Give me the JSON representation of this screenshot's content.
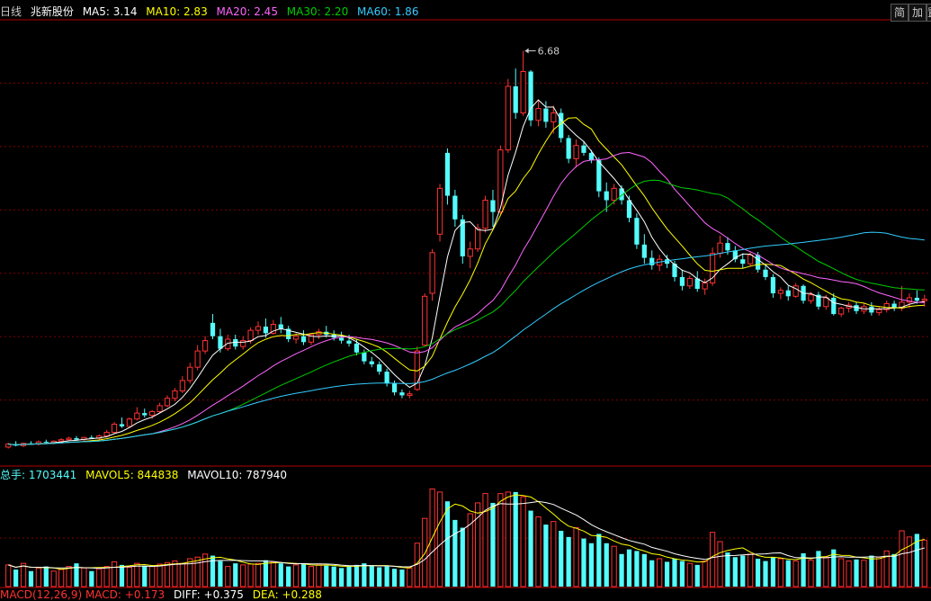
{
  "header": {
    "period": "日线",
    "stock_name": "兆新股份",
    "ma": [
      {
        "label": "MA5: 3.14",
        "color": "#ffffff"
      },
      {
        "label": "MA10: 2.83",
        "color": "#ffff00"
      },
      {
        "label": "MA20: 2.45",
        "color": "#ff66ff"
      },
      {
        "label": "MA30: 2.20",
        "color": "#00cc00"
      },
      {
        "label": "MA60: 1.86",
        "color": "#33ccff"
      }
    ]
  },
  "toolbar": {
    "simple_label": "简",
    "add_label": "加",
    "third_label": "置"
  },
  "volume_header": {
    "total": "总手: 1703441",
    "mavol5": "MAVOL5: 844838",
    "mavol10": "MAVOL10: 787940"
  },
  "macd_header": {
    "macd": "MACD(12,26,9)  MACD: +0.173",
    "diff": "DIFF: +0.375",
    "dea": "DEA: +0.288"
  },
  "colors": {
    "up": "#ff3232",
    "down": "#54fcfc",
    "grid": "#7f0000"
  },
  "chart_data": {
    "type": "candlestick",
    "annotations": [
      {
        "label": "6.68",
        "value": 6.68,
        "index": 68
      }
    ],
    "price_range": [
      1.1,
      7.1
    ],
    "candles": [
      [
        1.32,
        1.38,
        1.3,
        1.36
      ],
      [
        1.36,
        1.4,
        1.33,
        1.34
      ],
      [
        1.34,
        1.38,
        1.32,
        1.37
      ],
      [
        1.37,
        1.4,
        1.35,
        1.36
      ],
      [
        1.36,
        1.41,
        1.34,
        1.39
      ],
      [
        1.39,
        1.42,
        1.36,
        1.38
      ],
      [
        1.38,
        1.41,
        1.36,
        1.4
      ],
      [
        1.4,
        1.44,
        1.38,
        1.42
      ],
      [
        1.42,
        1.46,
        1.4,
        1.44
      ],
      [
        1.44,
        1.47,
        1.41,
        1.42
      ],
      [
        1.42,
        1.46,
        1.4,
        1.45
      ],
      [
        1.45,
        1.48,
        1.43,
        1.44
      ],
      [
        1.44,
        1.49,
        1.42,
        1.47
      ],
      [
        1.47,
        1.55,
        1.45,
        1.52
      ],
      [
        1.52,
        1.66,
        1.5,
        1.63
      ],
      [
        1.63,
        1.72,
        1.58,
        1.6
      ],
      [
        1.6,
        1.72,
        1.58,
        1.7
      ],
      [
        1.7,
        1.86,
        1.68,
        1.78
      ],
      [
        1.78,
        1.84,
        1.72,
        1.75
      ],
      [
        1.75,
        1.82,
        1.7,
        1.8
      ],
      [
        1.8,
        1.92,
        1.78,
        1.88
      ],
      [
        1.88,
        2.02,
        1.86,
        1.98
      ],
      [
        1.98,
        2.12,
        1.94,
        2.08
      ],
      [
        2.08,
        2.28,
        2.05,
        2.22
      ],
      [
        2.22,
        2.46,
        2.18,
        2.4
      ],
      [
        2.4,
        2.7,
        2.36,
        2.62
      ],
      [
        2.62,
        2.82,
        2.58,
        2.76
      ],
      [
        3.0,
        3.12,
        2.78,
        2.82
      ],
      [
        2.82,
        2.92,
        2.6,
        2.65
      ],
      [
        2.65,
        2.84,
        2.62,
        2.78
      ],
      [
        2.78,
        2.84,
        2.64,
        2.68
      ],
      [
        2.68,
        2.82,
        2.64,
        2.76
      ],
      [
        2.76,
        2.94,
        2.72,
        2.9
      ],
      [
        2.9,
        3.02,
        2.84,
        2.95
      ],
      [
        2.95,
        3.06,
        2.8,
        2.86
      ],
      [
        2.86,
        3.04,
        2.84,
        2.98
      ],
      [
        2.98,
        3.08,
        2.86,
        2.92
      ],
      [
        2.92,
        2.96,
        2.74,
        2.78
      ],
      [
        2.78,
        2.86,
        2.72,
        2.82
      ],
      [
        2.82,
        2.9,
        2.7,
        2.74
      ],
      [
        2.74,
        2.86,
        2.7,
        2.84
      ],
      [
        2.84,
        2.92,
        2.78,
        2.88
      ],
      [
        2.88,
        2.96,
        2.8,
        2.84
      ],
      [
        2.84,
        2.9,
        2.76,
        2.8
      ],
      [
        2.8,
        2.88,
        2.72,
        2.76
      ],
      [
        2.76,
        2.84,
        2.68,
        2.72
      ],
      [
        2.72,
        2.78,
        2.56,
        2.6
      ],
      [
        2.6,
        2.64,
        2.44,
        2.48
      ],
      [
        2.48,
        2.54,
        2.4,
        2.44
      ],
      [
        2.44,
        2.48,
        2.3,
        2.34
      ],
      [
        2.34,
        2.38,
        2.14,
        2.18
      ],
      [
        2.18,
        2.22,
        2.02,
        2.06
      ],
      [
        2.06,
        2.1,
        1.98,
        2.02
      ],
      [
        2.02,
        2.08,
        1.98,
        2.04
      ],
      [
        2.1,
        2.68,
        2.08,
        2.62
      ],
      [
        2.7,
        3.4,
        2.68,
        3.36
      ],
      [
        3.4,
        4.0,
        3.3,
        3.95
      ],
      [
        4.2,
        4.88,
        4.1,
        4.82
      ],
      [
        5.3,
        5.36,
        4.6,
        4.72
      ],
      [
        4.72,
        4.8,
        4.3,
        4.4
      ],
      [
        4.4,
        4.46,
        3.8,
        3.9
      ],
      [
        3.9,
        4.1,
        3.74,
        4.0
      ],
      [
        4.0,
        4.34,
        3.96,
        4.28
      ],
      [
        4.28,
        4.72,
        4.22,
        4.66
      ],
      [
        4.66,
        4.8,
        4.3,
        4.5
      ],
      [
        4.5,
        5.4,
        4.46,
        5.34
      ],
      [
        5.34,
        6.3,
        5.3,
        6.2
      ],
      [
        6.2,
        6.44,
        5.76,
        5.84
      ],
      [
        5.84,
        6.68,
        5.8,
        6.4
      ],
      [
        6.4,
        6.42,
        5.66,
        5.74
      ],
      [
        5.74,
        6.02,
        5.66,
        5.9
      ],
      [
        5.9,
        6.0,
        5.64,
        5.72
      ],
      [
        5.72,
        5.94,
        5.56,
        5.84
      ],
      [
        5.84,
        5.9,
        5.44,
        5.5
      ],
      [
        5.5,
        5.54,
        5.16,
        5.22
      ],
      [
        5.22,
        5.48,
        5.1,
        5.4
      ],
      [
        5.4,
        5.46,
        5.26,
        5.3
      ],
      [
        5.3,
        5.34,
        5.16,
        5.2
      ],
      [
        5.2,
        5.24,
        4.7,
        4.78
      ],
      [
        4.78,
        4.9,
        4.5,
        4.66
      ],
      [
        4.66,
        4.88,
        4.6,
        4.82
      ],
      [
        4.82,
        4.86,
        4.6,
        4.66
      ],
      [
        4.66,
        4.72,
        4.36,
        4.42
      ],
      [
        4.42,
        4.48,
        4.0,
        4.06
      ],
      [
        4.06,
        4.2,
        3.8,
        3.88
      ],
      [
        3.88,
        3.98,
        3.72,
        3.78
      ],
      [
        3.78,
        3.92,
        3.7,
        3.86
      ],
      [
        3.86,
        3.92,
        3.74,
        3.8
      ],
      [
        3.8,
        3.84,
        3.56,
        3.62
      ],
      [
        3.62,
        3.72,
        3.44,
        3.5
      ],
      [
        3.5,
        3.64,
        3.46,
        3.6
      ],
      [
        3.6,
        3.7,
        3.42,
        3.46
      ],
      [
        3.46,
        3.6,
        3.38,
        3.54
      ],
      [
        3.54,
        4.02,
        3.5,
        3.94
      ],
      [
        3.94,
        4.18,
        3.88,
        4.08
      ],
      [
        4.08,
        4.16,
        3.92,
        3.98
      ],
      [
        3.98,
        4.04,
        3.82,
        3.86
      ],
      [
        3.86,
        3.94,
        3.74,
        3.8
      ],
      [
        3.8,
        3.96,
        3.76,
        3.92
      ],
      [
        3.92,
        3.96,
        3.68,
        3.72
      ],
      [
        3.72,
        3.8,
        3.58,
        3.62
      ],
      [
        3.62,
        3.66,
        3.34,
        3.4
      ],
      [
        3.4,
        3.48,
        3.32,
        3.44
      ],
      [
        3.44,
        3.5,
        3.3,
        3.36
      ],
      [
        3.36,
        3.54,
        3.34,
        3.5
      ],
      [
        3.5,
        3.52,
        3.26,
        3.3
      ],
      [
        3.3,
        3.42,
        3.26,
        3.38
      ],
      [
        3.38,
        3.42,
        3.18,
        3.22
      ],
      [
        3.22,
        3.38,
        3.18,
        3.34
      ],
      [
        3.34,
        3.4,
        3.1,
        3.12
      ],
      [
        3.12,
        3.22,
        3.08,
        3.2
      ],
      [
        3.2,
        3.28,
        3.14,
        3.24
      ],
      [
        3.24,
        3.28,
        3.12,
        3.16
      ],
      [
        3.16,
        3.26,
        3.12,
        3.22
      ],
      [
        3.22,
        3.28,
        3.1,
        3.14
      ],
      [
        3.14,
        3.22,
        3.1,
        3.18
      ],
      [
        3.18,
        3.3,
        3.14,
        3.26
      ],
      [
        3.26,
        3.3,
        3.16,
        3.2
      ],
      [
        3.2,
        3.5,
        3.16,
        3.28
      ],
      [
        3.28,
        3.4,
        3.2,
        3.34
      ],
      [
        3.34,
        3.44,
        3.26,
        3.3
      ],
      [
        3.3,
        3.38,
        3.22,
        3.32
      ]
    ],
    "volume_range": [
      0,
      1300000
    ],
    "volume": [
      280000,
      220000,
      300000,
      200000,
      240000,
      260000,
      200000,
      220000,
      260000,
      300000,
      240000,
      200000,
      230000,
      260000,
      320000,
      280000,
      250000,
      300000,
      270000,
      260000,
      290000,
      310000,
      330000,
      300000,
      360000,
      380000,
      420000,
      400000,
      330000,
      260000,
      300000,
      280000,
      290000,
      300000,
      340000,
      320000,
      300000,
      260000,
      280000,
      300000,
      260000,
      280000,
      270000,
      260000,
      240000,
      260000,
      280000,
      300000,
      270000,
      250000,
      260000,
      230000,
      220000,
      240000,
      560000,
      880000,
      1260000,
      1220000,
      1100000,
      860000,
      760000,
      940000,
      1080000,
      1200000,
      1080000,
      1200000,
      1220000,
      1220000,
      1160000,
      980000,
      900000,
      800000,
      840000,
      720000,
      640000,
      760000,
      620000,
      560000,
      680000,
      560000,
      520000,
      420000,
      480000,
      460000,
      420000,
      340000,
      360000,
      320000,
      360000,
      330000,
      300000,
      280000,
      330000,
      700000,
      580000,
      440000,
      380000,
      400000,
      420000,
      360000,
      330000,
      380000,
      360000,
      340000,
      330000,
      430000,
      340000,
      460000,
      380000,
      480000,
      360000,
      330000,
      350000,
      340000,
      400000,
      380000,
      460000,
      420000,
      720000,
      640000,
      680000,
      600000
    ]
  }
}
